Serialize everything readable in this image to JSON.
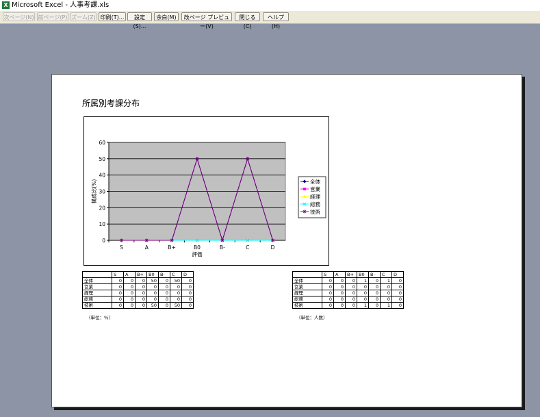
{
  "window": {
    "app_icon": "excel-icon",
    "title": "Microsoft Excel - 人事考課.xls"
  },
  "toolbar": {
    "next_page": "次ページ(N)",
    "prev_page": "前ページ(P)",
    "zoom": "ズーム(Z)",
    "print": "印刷(T)...",
    "setup": "設定(S)...",
    "margins": "余白(M)",
    "page_break_preview": "改ページ プレビュー(V)",
    "close": "閉じる(C)",
    "help": "ヘルプ(H)"
  },
  "sheet": {
    "heading": "所属別考課分布",
    "table_pct": {
      "columns": [
        "S",
        "A",
        "B+",
        "B0",
        "B-",
        "C",
        "D"
      ],
      "rows": [
        {
          "label": "全体",
          "values": [
            0,
            0,
            0,
            50,
            0,
            50,
            0
          ]
        },
        {
          "label": "営業",
          "values": [
            0,
            0,
            0,
            0,
            0,
            0,
            0
          ]
        },
        {
          "label": "経理",
          "values": [
            0,
            0,
            0,
            0,
            0,
            0,
            0
          ]
        },
        {
          "label": "総務",
          "values": [
            0,
            0,
            0,
            0,
            0,
            0,
            0
          ]
        },
        {
          "label": "技術",
          "values": [
            0,
            0,
            0,
            50,
            0,
            50,
            0
          ]
        }
      ],
      "unit": "（単位：％）"
    },
    "table_count": {
      "columns": [
        "S",
        "A",
        "B+",
        "B0",
        "B-",
        "C",
        "D"
      ],
      "rows": [
        {
          "label": "全体",
          "values": [
            0,
            0,
            0,
            1,
            0,
            1,
            0
          ]
        },
        {
          "label": "営業",
          "values": [
            0,
            0,
            0,
            0,
            0,
            0,
            0
          ]
        },
        {
          "label": "経理",
          "values": [
            0,
            0,
            0,
            0,
            0,
            0,
            0
          ]
        },
        {
          "label": "総務",
          "values": [
            0,
            0,
            0,
            0,
            0,
            0,
            0
          ]
        },
        {
          "label": "技術",
          "values": [
            0,
            0,
            0,
            1,
            0,
            1,
            0
          ]
        }
      ],
      "unit": "（単位：人数）"
    }
  },
  "chart_data": {
    "type": "line",
    "categories": [
      "S",
      "A",
      "B+",
      "B0",
      "B-",
      "C",
      "D"
    ],
    "xlabel": "評価",
    "ylabel": "構成比(%)",
    "ylim": [
      0,
      60
    ],
    "yticks": [
      0,
      10,
      20,
      30,
      40,
      50,
      60
    ],
    "grid": true,
    "plot_background": "#c0c0c0",
    "legend_position": "right",
    "series": [
      {
        "name": "全体",
        "color": "#000080",
        "marker": "diamond",
        "values": [
          0,
          0,
          0,
          50,
          0,
          50,
          0
        ]
      },
      {
        "name": "営業",
        "color": "#ff00ff",
        "marker": "square",
        "values": [
          0,
          0,
          0,
          0,
          0,
          0,
          0
        ]
      },
      {
        "name": "経理",
        "color": "#ffff00",
        "marker": "triangle",
        "values": [
          0,
          0,
          0,
          0,
          0,
          0,
          0
        ]
      },
      {
        "name": "総務",
        "color": "#00ffff",
        "marker": "x",
        "values": [
          0,
          0,
          0,
          0,
          0,
          0,
          0
        ]
      },
      {
        "name": "技術",
        "color": "#800080",
        "marker": "star",
        "values": [
          0,
          0,
          0,
          50,
          0,
          50,
          0
        ]
      }
    ]
  }
}
